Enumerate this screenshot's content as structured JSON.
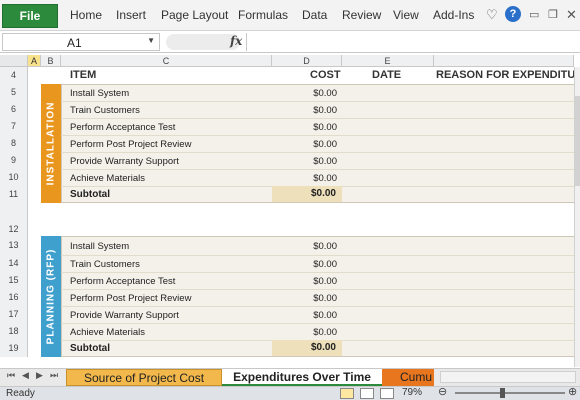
{
  "ribbon": {
    "file": "File",
    "tabs": [
      "Home",
      "Insert",
      "Page Layout",
      "Formulas",
      "Data",
      "Review",
      "View",
      "Add-Ins"
    ],
    "icons": [
      "heart-icon",
      "help-icon",
      "minimize-icon",
      "restore-icon",
      "close-icon"
    ],
    "help_glyph": "?"
  },
  "formula_bar": {
    "name_box": "A1",
    "fx": "fx",
    "value": ""
  },
  "columns": [
    "A",
    "B",
    "C",
    "D",
    "E"
  ],
  "headers": {
    "item": "ITEM",
    "cost": "COST",
    "date": "DATE",
    "reason": "REASON FOR EXPENDITU"
  },
  "rows": [
    "4",
    "5",
    "6",
    "7",
    "8",
    "9",
    "10",
    "11",
    "12",
    "13",
    "14",
    "15",
    "16",
    "17",
    "18",
    "19"
  ],
  "sections": [
    {
      "label": "INSTALLATION",
      "color": "#e8961e",
      "items": [
        {
          "task": "Install System",
          "cost": "$0.00"
        },
        {
          "task": "Train Customers",
          "cost": "$0.00"
        },
        {
          "task": "Perform Acceptance Test",
          "cost": "$0.00"
        },
        {
          "task": "Perform Post Project Review",
          "cost": "$0.00"
        },
        {
          "task": "Provide Warranty Support",
          "cost": "$0.00"
        },
        {
          "task": "Achieve Materials",
          "cost": "$0.00"
        }
      ],
      "subtotal_label": "Subtotal",
      "subtotal": "$0.00"
    },
    {
      "label": "PLANNING (RFP)",
      "color": "#3f9fcd",
      "items": [
        {
          "task": "Install System",
          "cost": "$0.00"
        },
        {
          "task": "Train Customers",
          "cost": "$0.00"
        },
        {
          "task": "Perform Acceptance Test",
          "cost": "$0.00"
        },
        {
          "task": "Perform Post Project Review",
          "cost": "$0.00"
        },
        {
          "task": "Provide Warranty Support",
          "cost": "$0.00"
        },
        {
          "task": "Achieve Materials",
          "cost": "$0.00"
        }
      ],
      "subtotal_label": "Subtotal",
      "subtotal": "$0.00"
    }
  ],
  "sheet_tabs": [
    {
      "label": "Source of Project Cost",
      "active": false,
      "color": "#f2b84b"
    },
    {
      "label": "Expenditures Over Time",
      "active": true,
      "color": "#ffffff"
    },
    {
      "label": "Cumu",
      "active": false,
      "color": "#e8761e"
    }
  ],
  "status": {
    "ready": "Ready",
    "zoom": "79%"
  }
}
